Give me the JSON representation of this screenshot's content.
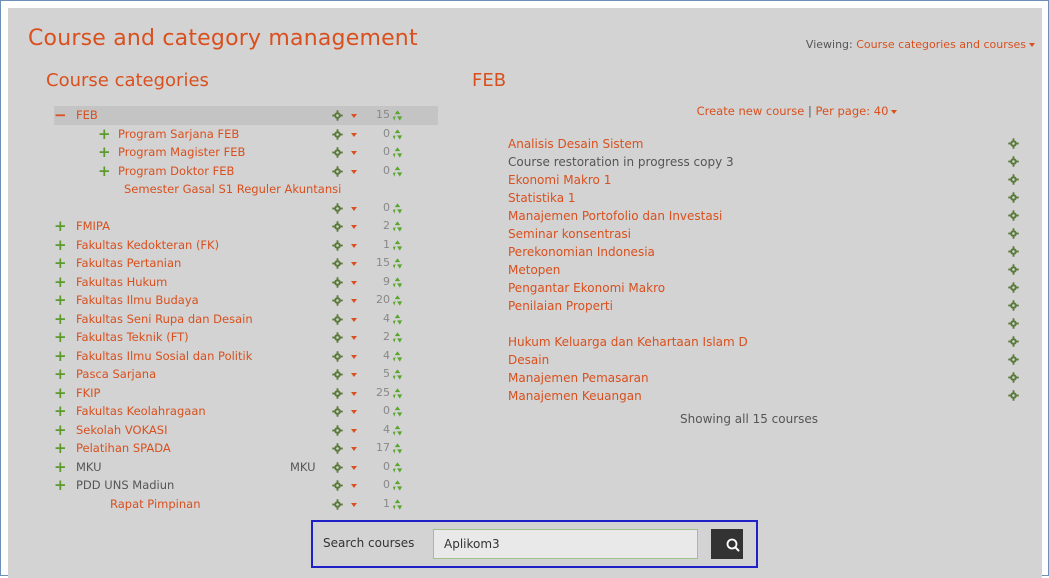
{
  "page": {
    "title": "Course and category management",
    "viewing_label": "Viewing:",
    "viewing_value": "Course categories and courses"
  },
  "categories": {
    "heading": "Course categories",
    "items": [
      {
        "label": "FEB",
        "count": "15",
        "expander": "collapse",
        "indent": 0,
        "selected": true
      },
      {
        "label": "Program Sarjana FEB",
        "count": "0",
        "expander": "expand",
        "indent": 1
      },
      {
        "label": "Program Magister FEB",
        "count": "0",
        "expander": "expand",
        "indent": 1
      },
      {
        "label": "Program Doktor FEB",
        "count": "0",
        "expander": "expand",
        "indent": 1
      },
      {
        "label": "Semester Gasal S1 Reguler Akuntansi",
        "count": "",
        "expander": "none",
        "indent": 2,
        "wrap": true
      },
      {
        "label": "",
        "count": "0",
        "expander": "none",
        "indent": 2,
        "controls_only": true
      },
      {
        "label": "FMIPA",
        "count": "2",
        "expander": "expand",
        "indent": 0
      },
      {
        "label": "Fakultas Kedokteran (FK)",
        "count": "1",
        "expander": "expand",
        "indent": 0
      },
      {
        "label": "Fakultas Pertanian",
        "count": "15",
        "expander": "expand",
        "indent": 0
      },
      {
        "label": "Fakultas Hukum",
        "count": "9",
        "expander": "expand",
        "indent": 0
      },
      {
        "label": "Fakultas Ilmu Budaya",
        "count": "20",
        "expander": "expand",
        "indent": 0
      },
      {
        "label": "Fakultas Seni Rupa dan Desain",
        "count": "4",
        "expander": "expand",
        "indent": 0
      },
      {
        "label": "Fakultas Teknik (FT)",
        "count": "2",
        "expander": "expand",
        "indent": 0
      },
      {
        "label": "Fakultas Ilmu Sosial dan Politik",
        "count": "4",
        "expander": "expand",
        "indent": 0
      },
      {
        "label": "Pasca Sarjana",
        "count": "5",
        "expander": "expand",
        "indent": 0
      },
      {
        "label": "FKIP",
        "count": "25",
        "expander": "expand",
        "indent": 0
      },
      {
        "label": "Fakultas Keolahragaan",
        "count": "0",
        "expander": "expand",
        "indent": 0
      },
      {
        "label": "Sekolah VOKASI",
        "count": "4",
        "expander": "expand",
        "indent": 0
      },
      {
        "label": "Pelatihan SPADA",
        "count": "17",
        "expander": "expand",
        "indent": 0
      },
      {
        "label": "MKU",
        "extra": "MKU",
        "count": "0",
        "expander": "expand",
        "indent": 0,
        "gray": true
      },
      {
        "label": "PDD UNS Madiun",
        "count": "0",
        "expander": "expand",
        "indent": 0,
        "gray": true
      },
      {
        "label": "Rapat Pimpinan",
        "count": "1",
        "expander": "none",
        "indent": 1
      }
    ]
  },
  "course_panel": {
    "heading": "FEB",
    "create_link": "Create new course",
    "separator": "|",
    "per_page": "Per page: 40",
    "courses": [
      {
        "name": "Analisis Desain Sistem",
        "gray": false
      },
      {
        "name": "Course restoration in progress copy 3",
        "gray": true
      },
      {
        "name": "Ekonomi Makro 1",
        "gray": false
      },
      {
        "name": "Statistika 1",
        "gray": false
      },
      {
        "name": "Manajemen Portofolio dan Investasi",
        "gray": false
      },
      {
        "name": "Seminar konsentrasi",
        "gray": false
      },
      {
        "name": "Perekonomian Indonesia",
        "gray": false
      },
      {
        "name": "Metopen",
        "gray": false
      },
      {
        "name": "Pengantar Ekonomi Makro",
        "gray": false
      },
      {
        "name": "Penilaian Properti",
        "gray": false
      },
      {
        "name": "",
        "gray": false
      },
      {
        "name": "Hukum Keluarga dan Kehartaan Islam D",
        "gray": false
      },
      {
        "name": "Desain",
        "gray": false
      },
      {
        "name": "Manajemen Pemasaran",
        "gray": false
      },
      {
        "name": "Manajemen Keuangan",
        "gray": false
      }
    ],
    "showing": "Showing all 15 courses"
  },
  "search": {
    "label": "Search courses",
    "value": "Aplikom3",
    "button_icon": "search-icon"
  },
  "colors": {
    "accent": "#d9501e",
    "expand_green": "#5c9a2c",
    "search_highlight": "#1f20c8"
  }
}
